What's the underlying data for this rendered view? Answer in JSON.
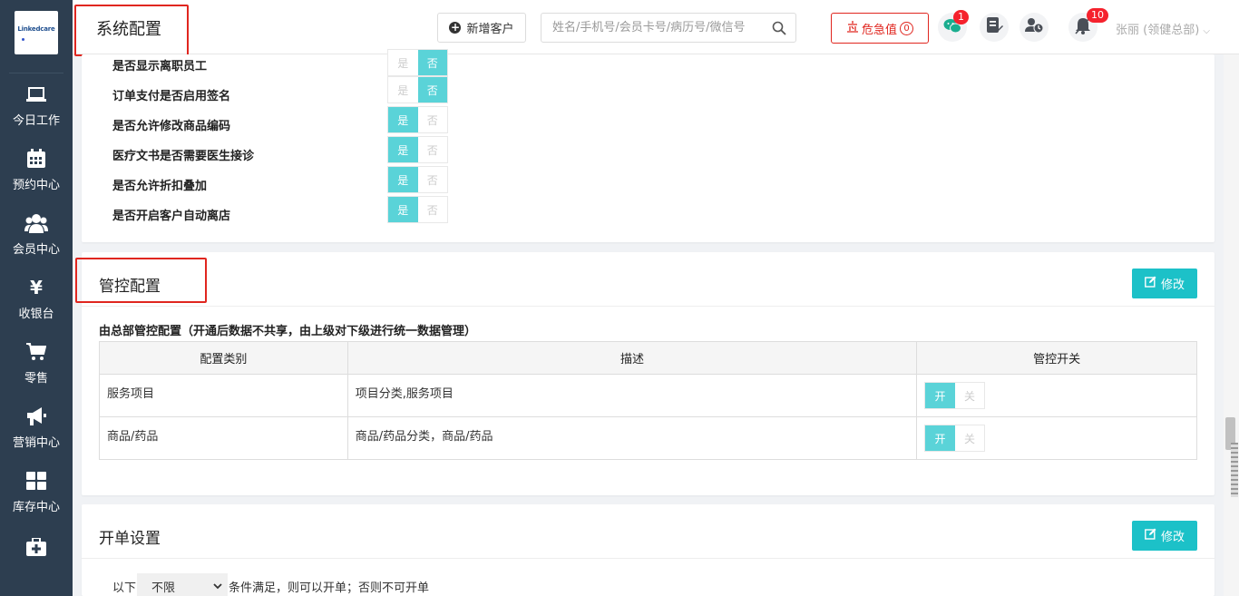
{
  "sidebar": {
    "logo_text": "Linkedcare",
    "items": [
      {
        "label": "今日工作",
        "icon": "laptop-icon"
      },
      {
        "label": "预约中心",
        "icon": "calendar-icon"
      },
      {
        "label": "会员中心",
        "icon": "users-icon"
      },
      {
        "label": "收银台",
        "icon": "yen-icon"
      },
      {
        "label": "零售",
        "icon": "cart-icon"
      },
      {
        "label": "营销中心",
        "icon": "megaphone-icon"
      },
      {
        "label": "库存中心",
        "icon": "grid-icon"
      },
      {
        "label": "",
        "icon": "medkit-icon"
      }
    ]
  },
  "header": {
    "title": "系统配置",
    "add_customer": "新增客户",
    "search_placeholder": "姓名/手机号/会员卡号/病历号/微信号",
    "danger_label": "危急值",
    "danger_count": "0",
    "wechat_badge": "1",
    "notify_badge": "10",
    "user": "张丽 (领健总部)"
  },
  "system_config": {
    "yes": "是",
    "no": "否",
    "items": [
      {
        "label": "是否显示离职员工",
        "value": "否"
      },
      {
        "label": "订单支付是否启用签名",
        "value": "否"
      },
      {
        "label": "是否允许修改商品编码",
        "value": "是"
      },
      {
        "label": "医疗文书是否需要医生接诊",
        "value": "是"
      },
      {
        "label": "是否允许折扣叠加",
        "value": "是"
      },
      {
        "label": "是否开启客户自动离店",
        "value": "是"
      }
    ]
  },
  "control_config": {
    "title": "管控配置",
    "edit_label": "修改",
    "description": "由总部管控配置（开通后数据不共享，由上级对下级进行统一数据管理）",
    "columns": [
      "配置类别",
      "描述",
      "管控开关"
    ],
    "on_label": "开",
    "off_label": "关",
    "rows": [
      {
        "category": "服务项目",
        "desc": "项目分类,服务项目",
        "value": "开"
      },
      {
        "category": "商品/药品",
        "desc": "商品/药品分类，商品/药品",
        "value": "开"
      }
    ]
  },
  "order_settings": {
    "title": "开单设置",
    "edit_label": "修改",
    "prefix": "以下",
    "select_value": "不限",
    "suffix": "条件满足，则可以开单；否则不可开单"
  },
  "colors": {
    "sidebar": "#2d3e50",
    "accent": "#1cc1c8",
    "toggle_on": "#5ad3d8",
    "danger": "#e0261f"
  }
}
